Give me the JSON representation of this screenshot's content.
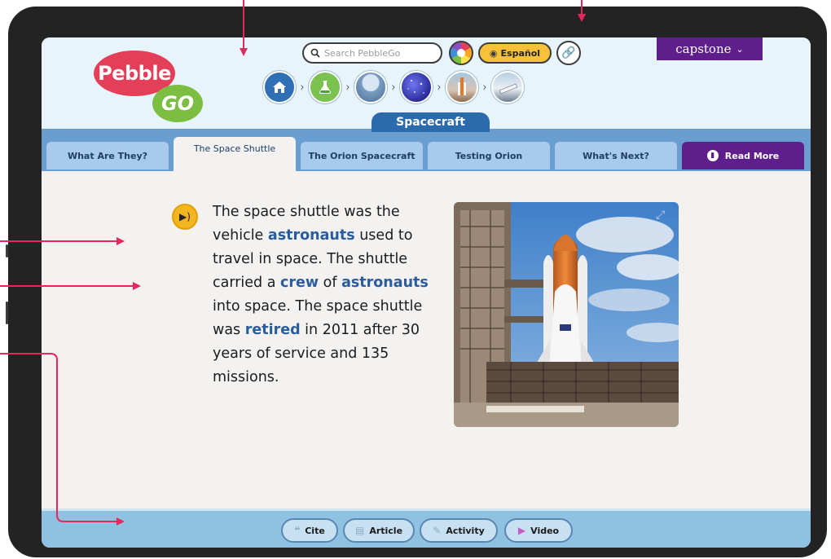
{
  "header": {
    "logo_top": "Pebble",
    "logo_bottom": "GO",
    "search_placeholder": "Search PebbleGo",
    "language_label": "Español",
    "brand_menu_label": "capstone",
    "breadcrumb_icons": [
      "home-icon",
      "science-flask-icon",
      "astronaut-icon",
      "galaxy-icon",
      "space-shuttle-icon",
      "spacecraft-icon"
    ]
  },
  "section": {
    "title": "Spacecraft"
  },
  "tabs": [
    {
      "label": "What Are They?",
      "active": false
    },
    {
      "label": "The Space Shuttle",
      "active": true
    },
    {
      "label": "The Orion Spacecraft",
      "active": false
    },
    {
      "label": "Testing Orion",
      "active": false
    },
    {
      "label": "What's Next?",
      "active": false
    },
    {
      "label": "Read More",
      "active": false
    }
  ],
  "article": {
    "t1": "The space shuttle was the vehicle ",
    "v1": "astronauts",
    "t2": " used to travel in space. The shuttle carried a ",
    "v2": "crew",
    "t3": " of ",
    "v3": "astronauts",
    "t4": " into space. The space shuttle was ",
    "v4": "retired",
    "t5": " in 2011 after 30 years of service and 135 missions."
  },
  "bottom_bar": {
    "cite": "Cite",
    "article": "Article",
    "activity": "Activity",
    "video": "Video"
  },
  "colors": {
    "accent_blue": "#2a6aad",
    "vocab_blue": "#2b5d9d",
    "brand_purple": "#5e1f8c",
    "logo_red": "#e43f59",
    "logo_green": "#7cbe42",
    "annotation_pink": "#e8265e"
  }
}
